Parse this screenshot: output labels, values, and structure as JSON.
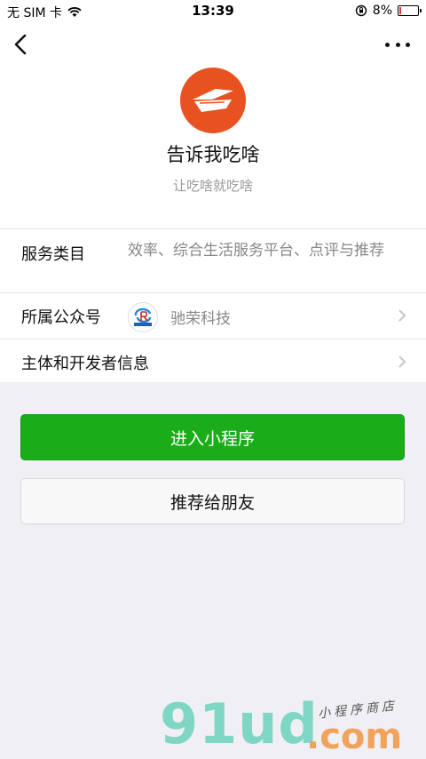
{
  "status_bar": {
    "carrier": "无 SIM 卡",
    "time": "13:39",
    "battery_percent": "8%",
    "battery_level": 0.08
  },
  "nav": {
    "back_icon": "chevron-left-icon",
    "more_icon": "more-dots-icon"
  },
  "app": {
    "name": "告诉我吃啥",
    "slogan": "让吃啥就吃啥",
    "logo_color": "#e85220"
  },
  "info": {
    "service_label": "服务类目",
    "service_value": "效率、综合生活服务平台、点评与推荐",
    "account_label": "所属公众号",
    "account_name": "驰荣科技",
    "account_logo_text": "驰荣科技",
    "developer_label": "主体和开发者信息"
  },
  "buttons": {
    "enter_label": "进入小程序",
    "share_label": "推荐给朋友"
  },
  "watermark": {
    "main": "91ud",
    "suffix": ".com",
    "tag": "小程序商店"
  },
  "colors": {
    "primary_green": "#1aad19",
    "background": "#efeff4"
  }
}
